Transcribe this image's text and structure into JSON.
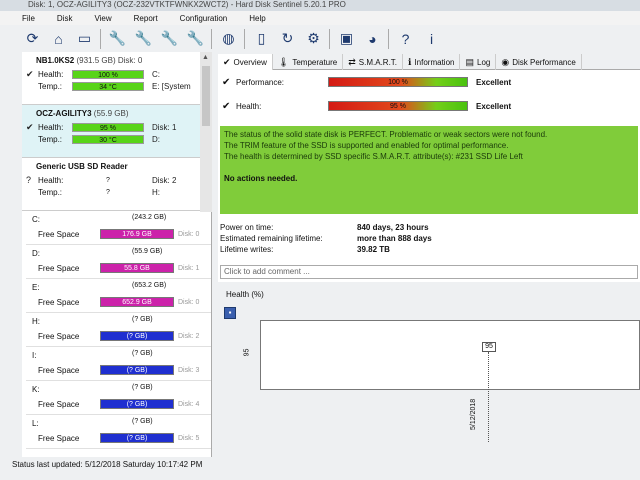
{
  "window": {
    "title": "Disk: 1, OCZ-AGILITY3 (OCZ-232VTKTFWNKX2WCT2) - Hard Disk Sentinel 5.20.1 PRO"
  },
  "menu": [
    "File",
    "Disk",
    "View",
    "Report",
    "Configuration",
    "Help"
  ],
  "toolbar": [
    "refresh-icon",
    "home-icon",
    "disk-icon",
    "wrench-icon",
    "wrench-icon",
    "wrench-icon",
    "wrench-icon",
    "globe-icon",
    "device-icon",
    "sync-icon",
    "network-icon",
    "monitor-icon",
    "bell-icon",
    "help-icon",
    "info-icon"
  ],
  "disks": [
    {
      "name": "NB1.0KS2",
      "size": "(931.5 GB)",
      "disk": "Disk: 0",
      "health_label": "Health:",
      "health": "100 %",
      "health_level": 1.0,
      "temp_label": "Temp.:",
      "temp": "34 °C",
      "vol1": "C:",
      "vol2": "E: [System"
    },
    {
      "name": "OCZ-AGILITY3",
      "size": "(55.9 GB)",
      "disk": "",
      "health_label": "Health:",
      "health": "95 %",
      "health_level": 0.95,
      "temp_label": "Temp.:",
      "temp": "30 °C",
      "vol1": "Disk: 1",
      "vol2": "D:"
    },
    {
      "name": "Generic USB SD Reader",
      "size": "",
      "disk": "",
      "health_label": "Health:",
      "health": "?",
      "temp_label": "Temp.:",
      "temp": "?",
      "vol1": "Disk: 2",
      "vol2": "H:"
    }
  ],
  "partitions": [
    {
      "letter": "C:",
      "size": "(243.2 GB)",
      "fs_label": "Free Space",
      "free": "176.9 GB",
      "disk": "Disk: 0",
      "color": "#cc22aa"
    },
    {
      "letter": "D:",
      "size": "(55.9 GB)",
      "fs_label": "Free Space",
      "free": "55.8 GB",
      "disk": "Disk: 1",
      "color": "#cc22aa"
    },
    {
      "letter": "E:",
      "size": "(653.2 GB)",
      "fs_label": "Free Space",
      "free": "652.9 GB",
      "disk": "Disk: 0",
      "color": "#cc22aa"
    },
    {
      "letter": "H:",
      "size": "(? GB)",
      "fs_label": "Free Space",
      "free": "(? GB)",
      "disk": "Disk: 2",
      "color": "#1f2fd0"
    },
    {
      "letter": "I:",
      "size": "(? GB)",
      "fs_label": "Free Space",
      "free": "(? GB)",
      "disk": "Disk: 3",
      "color": "#1f2fd0"
    },
    {
      "letter": "K:",
      "size": "(? GB)",
      "fs_label": "Free Space",
      "free": "(? GB)",
      "disk": "Disk: 4",
      "color": "#1f2fd0"
    },
    {
      "letter": "L:",
      "size": "(? GB)",
      "fs_label": "Free Space",
      "free": "(? GB)",
      "disk": "Disk: 5",
      "color": "#1f2fd0"
    }
  ],
  "status": "Status last updated: 5/12/2018 Saturday 10:17:42 PM",
  "tabs": [
    {
      "label": "Overview",
      "icon": "check-icon",
      "glyph": "✔"
    },
    {
      "label": "Temperature",
      "icon": "thermometer-icon",
      "glyph": "🌡"
    },
    {
      "label": "S.M.A.R.T.",
      "icon": "smart-icon",
      "glyph": "⇄"
    },
    {
      "label": "Information",
      "icon": "info-icon",
      "glyph": "ℹ"
    },
    {
      "label": "Log",
      "icon": "log-icon",
      "glyph": "▤"
    },
    {
      "label": "Disk Performance",
      "icon": "gauge-icon",
      "glyph": "◉"
    }
  ],
  "overview": {
    "performance_label": "Performance:",
    "performance": "100 %",
    "performance_level": 1.0,
    "performance_grade": "Excellent",
    "health_label": "Health:",
    "health": "95 %",
    "health_level": 0.95,
    "health_grade": "Excellent",
    "message": [
      "The status of the solid state disk is PERFECT. Problematic or weak sectors were not found.",
      "The TRIM feature of the SSD is supported and enabled for optimal performance.",
      "The health is determined by SSD specific S.M.A.R.T. attribute(s): #231 SSD Life Left"
    ],
    "actions": "No actions needed.",
    "power_on_label": "Power on time:",
    "power_on": "840 days, 23 hours",
    "lifetime_label": "Estimated remaining lifetime:",
    "lifetime": "more than 888 days",
    "writes_label": "Lifetime writes:",
    "writes": "39.82 TB",
    "comment_placeholder": "Click to add comment ..."
  },
  "chart_data": {
    "type": "line",
    "title": "Health (%)",
    "x": [
      "5/12/2018"
    ],
    "series": [
      {
        "values": [
          95
        ]
      }
    ],
    "ytick": "95"
  }
}
